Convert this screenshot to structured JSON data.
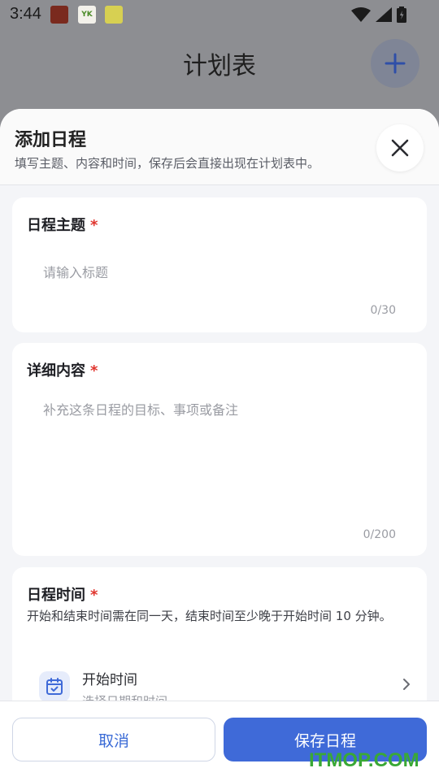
{
  "status_bar": {
    "time": "3:44"
  },
  "page": {
    "title": "计划表",
    "fab_icon": "plus-icon"
  },
  "sheet": {
    "title": "添加日程",
    "subtitle": "填写主题、内容和时间，保存后会直接出现在计划表中。",
    "close_icon": "close-icon"
  },
  "title_field": {
    "label": "日程主题",
    "required_mark": "*",
    "placeholder": "请输入标题",
    "counter": "0/30"
  },
  "content_field": {
    "label": "详细内容",
    "required_mark": "*",
    "placeholder": "补充这条日程的目标、事项或备注",
    "counter": "0/200"
  },
  "time_field": {
    "label": "日程时间",
    "required_mark": "*",
    "hint": "开始和结束时间需在同一天，结束时间至少晚于开始时间 10 分钟。",
    "start_label": "开始时间",
    "start_value": "选择日期和时间"
  },
  "footer": {
    "cancel_label": "取消",
    "save_label": "保存日程"
  },
  "watermark": "ITMOP.COM",
  "colors": {
    "accent": "#3f6ad8",
    "required": "#e0342d",
    "placeholder": "#9a9ca3"
  }
}
